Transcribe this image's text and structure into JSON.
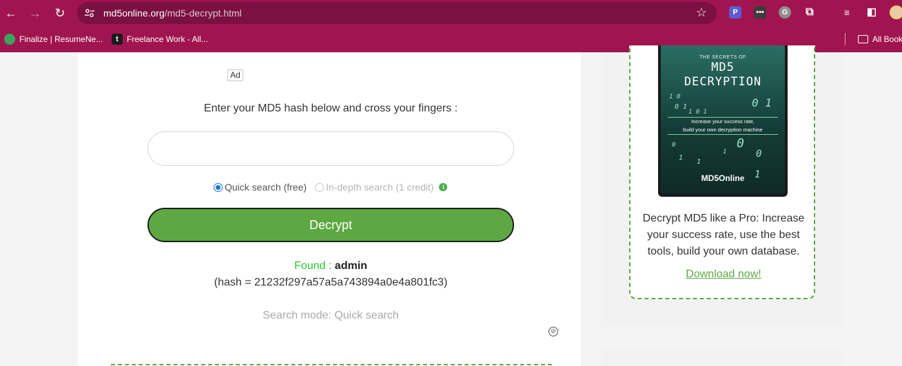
{
  "browser": {
    "url_domain": "md5online.org",
    "url_path": "/md5-decrypt.html",
    "bookmarks": [
      {
        "label": "Finalize | ResumeNe..."
      },
      {
        "label": "Freelance Work - All..."
      }
    ],
    "all_bookmarks_label": "All Bookmarks"
  },
  "main": {
    "ad_label": "Ad",
    "prompt": "Enter your MD5 hash below and cross your fingers :",
    "hash_input_value": "",
    "radio_quick": "Quick search (free)",
    "radio_indepth": "In-depth search (1 credit)",
    "decrypt_label": "Decrypt",
    "found_label": "Found :",
    "found_value": "admin",
    "hash_line": "(hash = 21232f297a57a5a743894a0e4a801fc3)",
    "search_mode": "Search mode: Quick search"
  },
  "sidebar": {
    "book_top": "THE SECRETS OF",
    "book_title_1": "MD5",
    "book_title_2": "DECRYPTION",
    "book_subtitle_1": "Increase your success rate,",
    "book_subtitle_2": "build your own decryption machine",
    "book_brand": "MD5Online",
    "description": "Decrypt MD5 like a Pro: Increase your success rate, use the best tools, build your own database.",
    "download_link": "Download now!"
  },
  "colors": {
    "browser_chrome": "#a0154f",
    "accent_green": "#5ea844",
    "found_green": "#2ec52e"
  }
}
